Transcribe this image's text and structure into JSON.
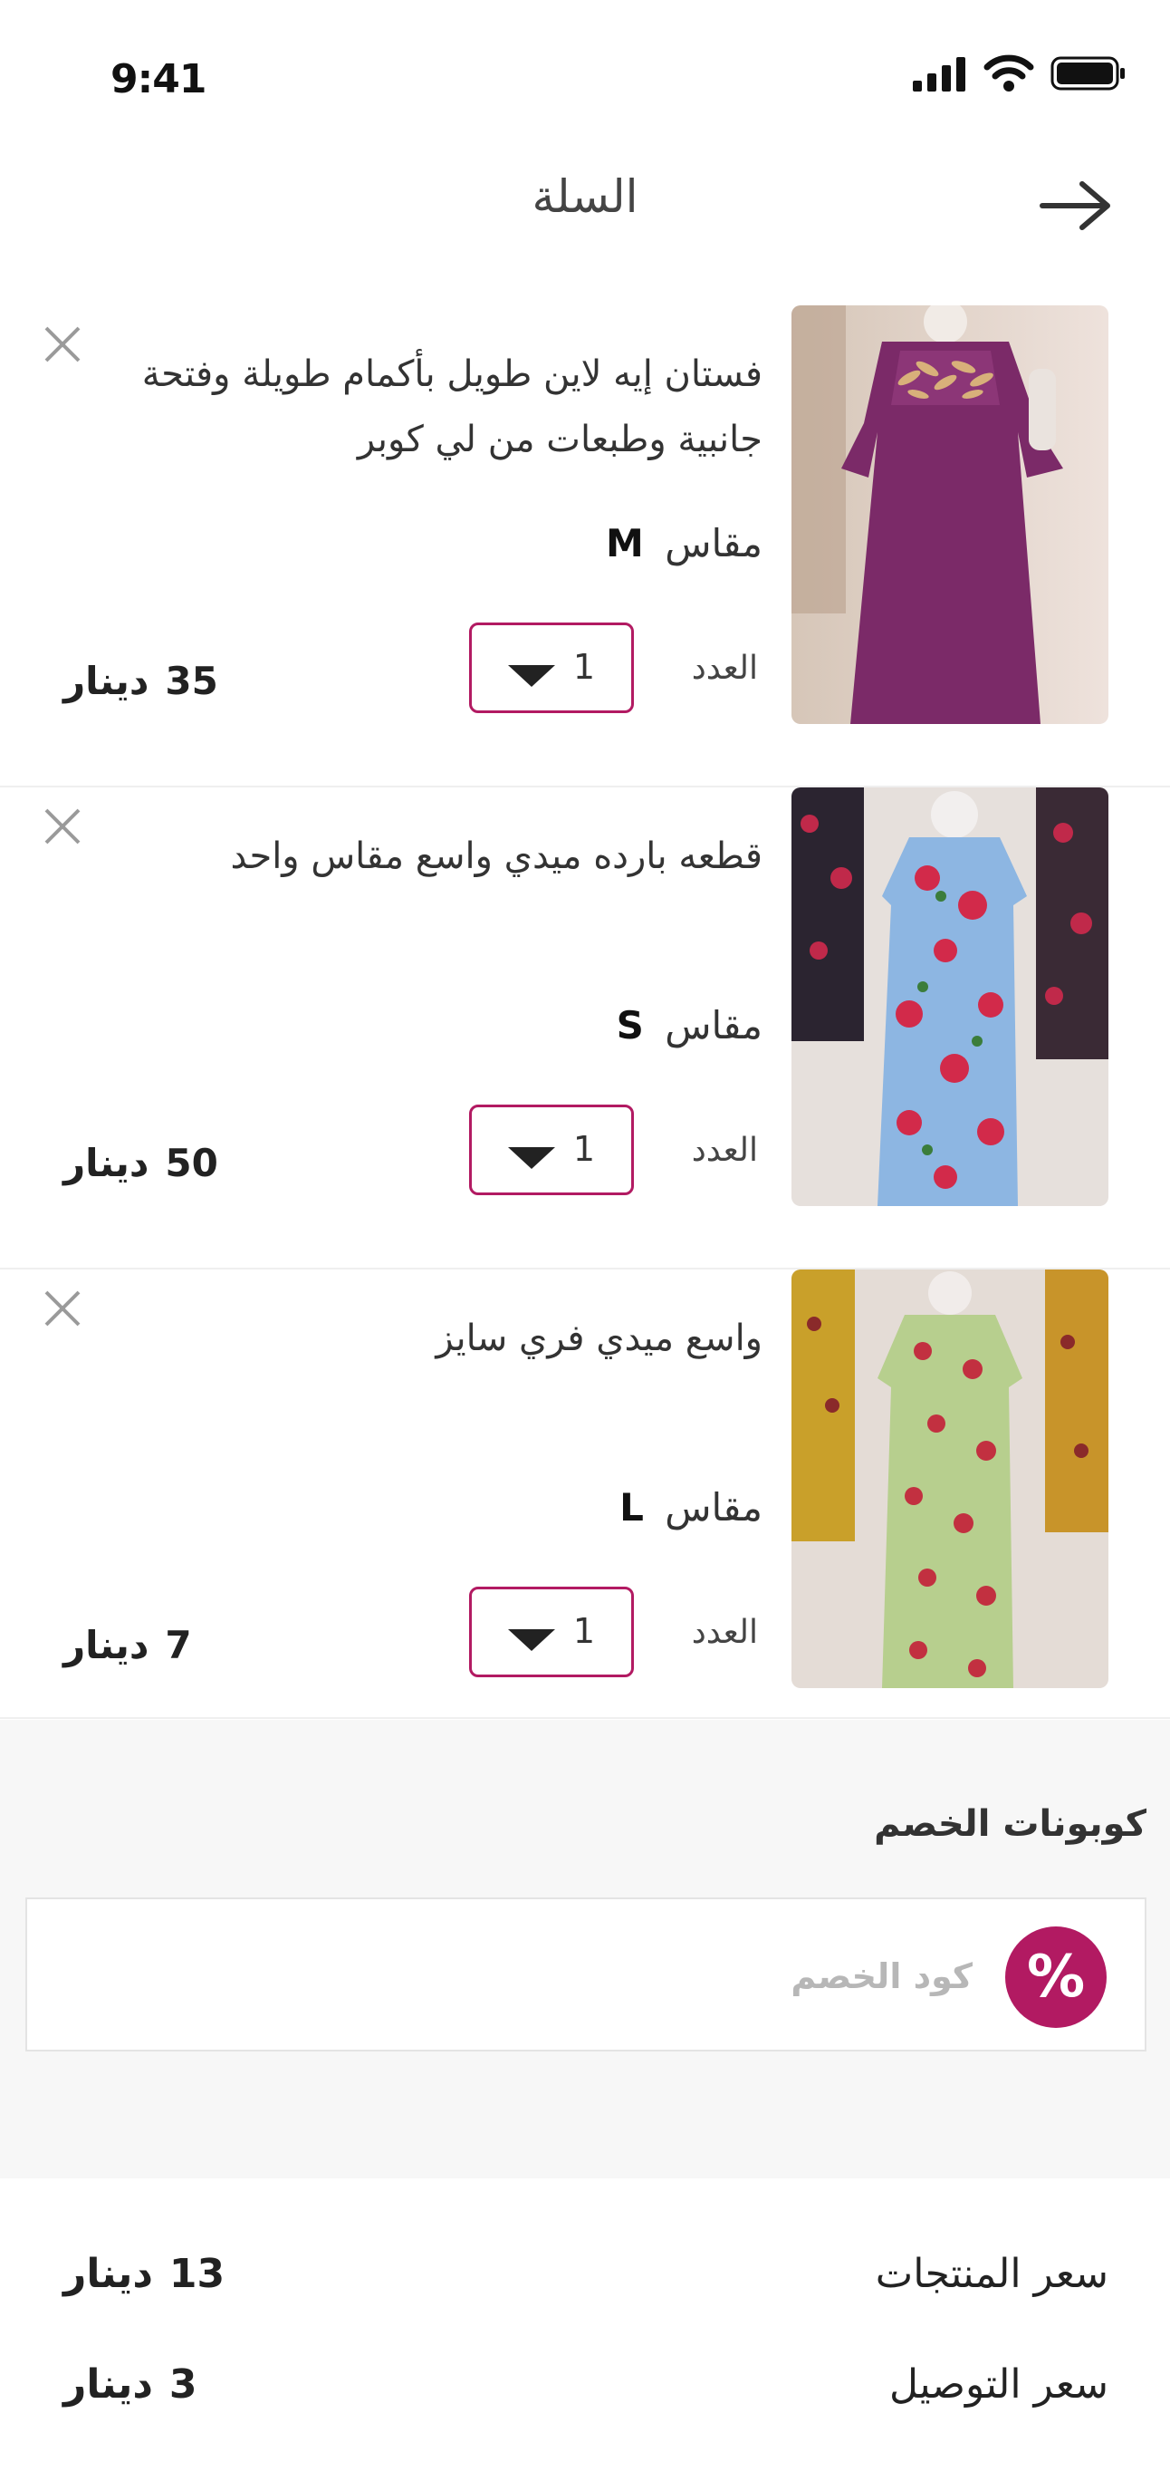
{
  "status_bar": {
    "time": "9:41"
  },
  "header": {
    "title": "السلة"
  },
  "items": [
    {
      "name": "فستان إيه لاين طويل بأكمام طويلة وفتحة جانبية وطبعات من لي كوبر",
      "size_label": "مقاس",
      "size": "M",
      "qty_label": "العدد",
      "qty": "1",
      "price": "35",
      "currency": "دينار"
    },
    {
      "name": "قطعه بارده ميدي واسع مقاس واحد",
      "size_label": "مقاس",
      "size": "S",
      "qty_label": "العدد",
      "qty": "1",
      "price": "50",
      "currency": "دينار"
    },
    {
      "name": "واسع ميدي فري سايز",
      "size_label": "مقاس",
      "size": "L",
      "qty_label": "العدد",
      "qty": "1",
      "price": "7",
      "currency": "دينار"
    }
  ],
  "coupon": {
    "title": "كوبونات الخصم",
    "icon_symbol": "%",
    "placeholder": "كود الخصم"
  },
  "summary": {
    "rows": [
      {
        "label": "سعر المنتجات",
        "value": "13",
        "currency": "دينار"
      },
      {
        "label": "سعر التوصيل",
        "value": "3",
        "currency": "دينار"
      }
    ]
  },
  "colors": {
    "accent": "#b21a62"
  }
}
